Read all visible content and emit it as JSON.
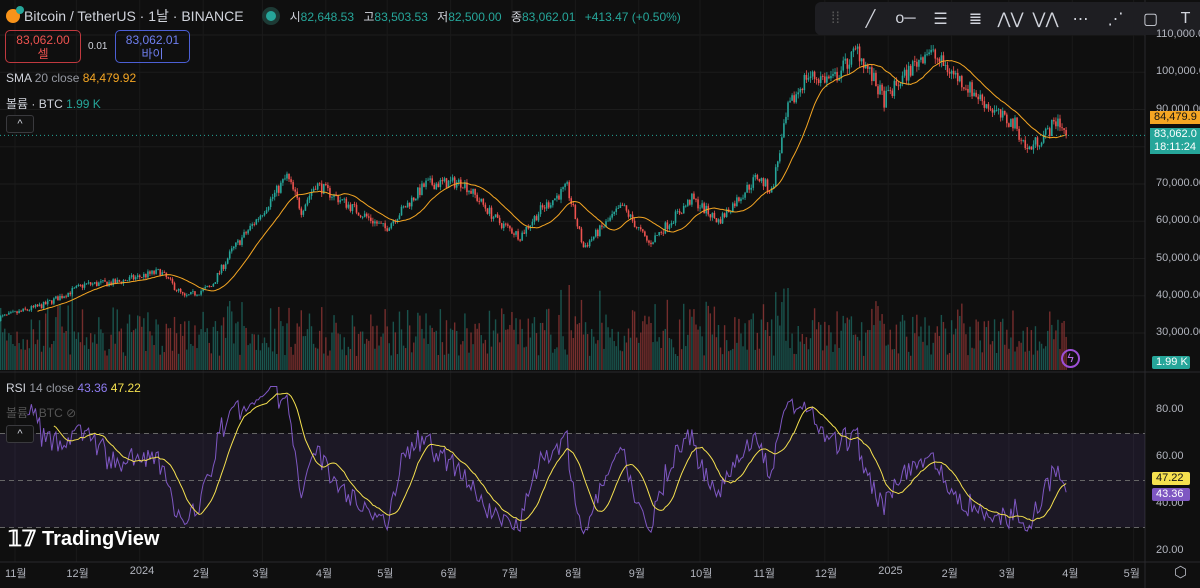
{
  "header": {
    "symbol": "Bitcoin / TetherUS · 1날 · BINANCE",
    "open_label": "시",
    "open": "82,648.53",
    "high_label": "고",
    "high": "83,503.53",
    "low_label": "저",
    "low": "82,500.00",
    "close_label": "종",
    "close": "83,062.01",
    "change": "+413.47 (+0.50%)"
  },
  "trade": {
    "sell_price": "83,062.00",
    "sell_label": "셀",
    "spread": "0.01",
    "buy_price": "83,062.01",
    "buy_label": "바이"
  },
  "legends": {
    "sma_name": "SMA",
    "sma_params": "20 close",
    "sma_value": "84,479.92",
    "vol_name": "볼륨 · BTC",
    "vol_value": "1.99 K",
    "rsi_name": "RSI",
    "rsi_params": "14 close",
    "rsi_value": "43.36",
    "rsi_ma_value": "47.22",
    "vol_hidden_label": "볼륨 · BTC",
    "collapse": "^"
  },
  "price_tags": {
    "sma": "84,479.9",
    "last": "83,062.0",
    "countdown": "18:11:24",
    "volume": "1.99 K",
    "rsi": "43.36",
    "rsi_ma": "47.22"
  },
  "toolbar": [
    "drag-handle",
    "trend-line",
    "horizontal-ray",
    "parallel-channel",
    "fib-retracement",
    "elliott-wave",
    "abcd-pattern",
    "long-position",
    "short-position",
    "rectangle",
    "text"
  ],
  "brand": "TradingView",
  "colors": {
    "up": "#26a69a",
    "down": "#ef5350",
    "sma": "#f5a623",
    "rsi": "#7e57c2",
    "rsi_ma": "#f5e14f",
    "bg": "#0f0f0f"
  },
  "chart_data": {
    "type": "candlestick",
    "title": "Bitcoin / TetherUS · 1날 · BINANCE",
    "price_axis": {
      "ticks": [
        "30,000.00",
        "40,000.00",
        "50,000.00",
        "60,000.00",
        "70,000.00",
        "80,000.00",
        "90,000.00",
        "100,000.00",
        "110,000.00"
      ],
      "range": [
        25000,
        112000
      ]
    },
    "rsi_axis": {
      "ticks": [
        "20.00",
        "40.00",
        "60.00",
        "80.00"
      ],
      "range": [
        15,
        90
      ],
      "bands": [
        30,
        50,
        70
      ]
    },
    "x_ticks": [
      "11월",
      "12월",
      "2024",
      "2월",
      "3월",
      "4월",
      "5월",
      "6월",
      "7월",
      "8월",
      "9월",
      "10월",
      "11월",
      "12월",
      "2025",
      "2월",
      "3월",
      "4월",
      "5월"
    ],
    "close_path": [
      [
        "2023-10-24",
        34000
      ],
      [
        "2023-11-15",
        37500
      ],
      [
        "2023-12-05",
        43000
      ],
      [
        "2023-12-20",
        43500
      ],
      [
        "2024-01-11",
        46500
      ],
      [
        "2024-01-23",
        39500
      ],
      [
        "2024-02-05",
        42500
      ],
      [
        "2024-02-15",
        52000
      ],
      [
        "2024-02-28",
        61000
      ],
      [
        "2024-03-13",
        72000
      ],
      [
        "2024-03-20",
        63000
      ],
      [
        "2024-03-27",
        70000
      ],
      [
        "2024-04-13",
        64000
      ],
      [
        "2024-04-30",
        58000
      ],
      [
        "2024-05-20",
        70000
      ],
      [
        "2024-06-07",
        70500
      ],
      [
        "2024-06-24",
        60000
      ],
      [
        "2024-07-05",
        56000
      ],
      [
        "2024-07-15",
        63000
      ],
      [
        "2024-07-28",
        69000
      ],
      [
        "2024-08-05",
        53000
      ],
      [
        "2024-08-24",
        64000
      ],
      [
        "2024-09-06",
        54000
      ],
      [
        "2024-09-27",
        66000
      ],
      [
        "2024-10-10",
        60000
      ],
      [
        "2024-10-29",
        72000
      ],
      [
        "2024-11-05",
        68000
      ],
      [
        "2024-11-13",
        90000
      ],
      [
        "2024-11-22",
        99000
      ],
      [
        "2024-12-05",
        98000
      ],
      [
        "2024-12-17",
        106000
      ],
      [
        "2024-12-30",
        92500
      ],
      [
        "2025-01-20",
        106000
      ],
      [
        "2025-02-01",
        100000
      ],
      [
        "2025-02-25",
        88000
      ],
      [
        "2025-03-04",
        86000
      ],
      [
        "2025-03-10",
        79000
      ],
      [
        "2025-03-20",
        84000
      ],
      [
        "2025-03-25",
        87500
      ],
      [
        "2025-03-29",
        83062
      ]
    ],
    "indicators": {
      "sma": {
        "period": 20,
        "last": 84479.92
      },
      "rsi": {
        "period": 14,
        "last": 43.36,
        "ma_last": 47.22
      },
      "volume_last": "1.99 K"
    }
  }
}
